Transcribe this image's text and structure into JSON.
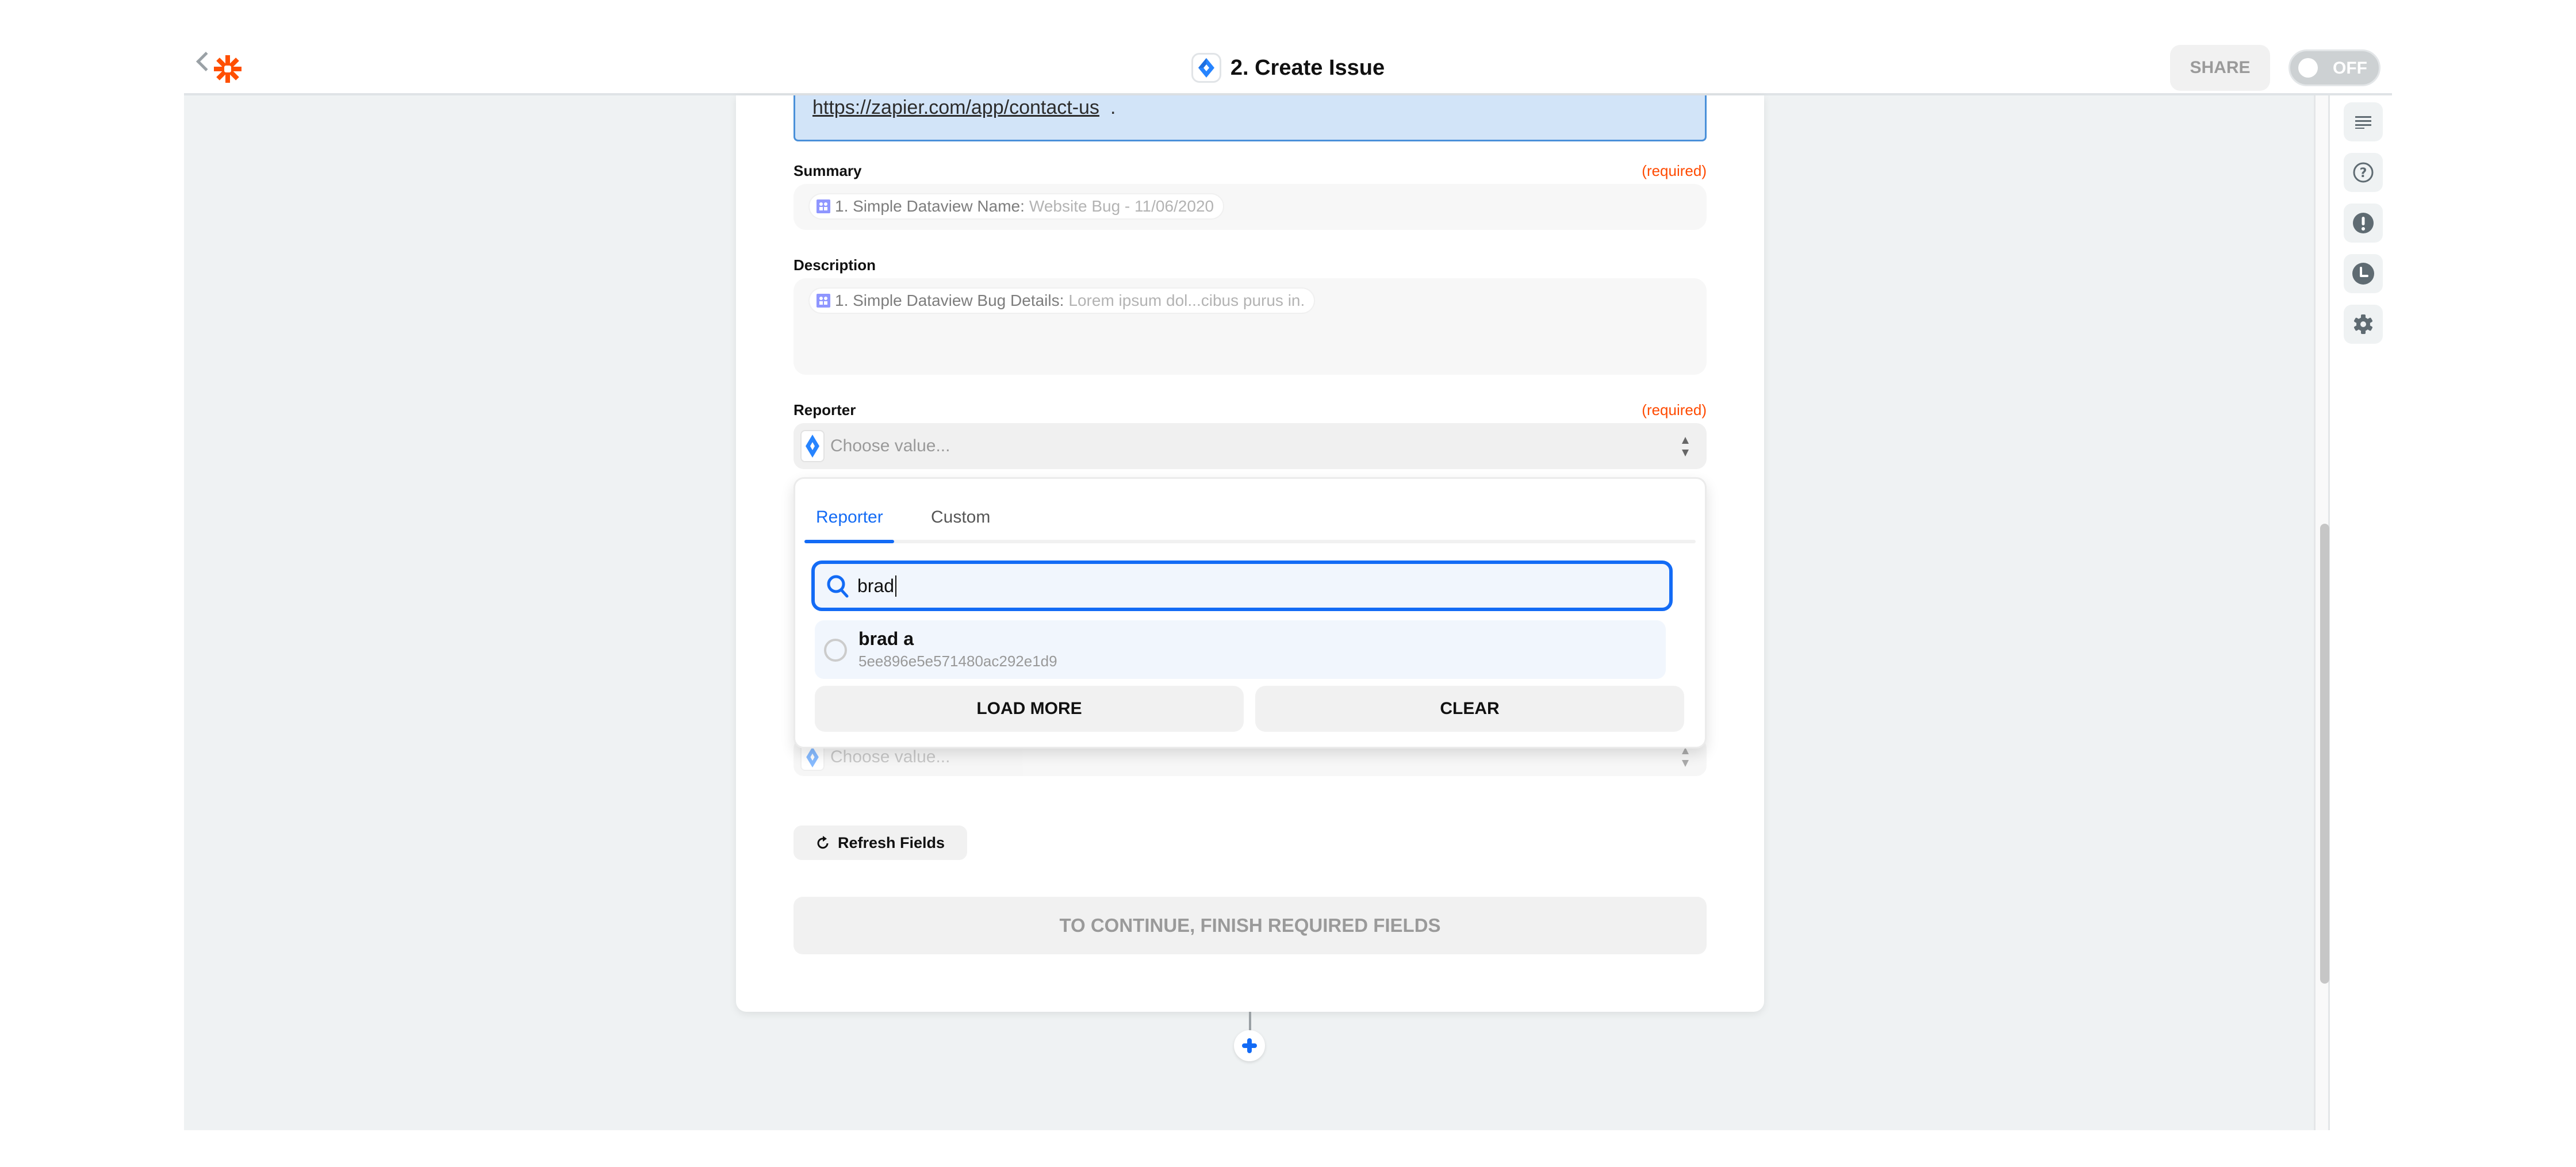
{
  "header": {
    "step_title": "2. Create Issue",
    "share_label": "SHARE",
    "toggle_label": "OFF",
    "toggle_state": "off"
  },
  "colors": {
    "brand_orange": "#ff4f00",
    "accent_blue": "#136bf5",
    "required_orange": "#ff4a00",
    "info_bg": "#d2e4f8"
  },
  "info_box": {
    "link_text": "https://zapier.com/app/contact-us",
    "trailing": "."
  },
  "fields": {
    "summary": {
      "label": "Summary",
      "required_label": "(required)",
      "pill_key": "1. Simple Dataview Name:",
      "pill_value": "Website Bug - 11/06/2020"
    },
    "description": {
      "label": "Description",
      "pill_key": "1. Simple Dataview Bug Details:",
      "pill_value": "Lorem ipsum dol...cibus purus in."
    },
    "reporter": {
      "label": "Reporter",
      "required_label": "(required)",
      "placeholder": "Choose value..."
    },
    "hidden_select": {
      "placeholder": "Choose value..."
    }
  },
  "dropdown": {
    "tabs": [
      {
        "label": "Reporter",
        "active": true
      },
      {
        "label": "Custom",
        "active": false
      }
    ],
    "search_value": "brad",
    "options": [
      {
        "name": "brad a",
        "id": "5ee896e5e571480ac292e1d9",
        "selected": false
      }
    ],
    "load_more_label": "LOAD MORE",
    "clear_label": "CLEAR"
  },
  "actions": {
    "refresh_label": "Refresh Fields",
    "continue_label": "TO CONTINUE, FINISH REQUIRED FIELDS"
  },
  "right_rail": {
    "items": [
      {
        "icon": "details-lines-icon"
      },
      {
        "icon": "help-circle-icon"
      },
      {
        "icon": "alert-icon"
      },
      {
        "icon": "clock-icon"
      },
      {
        "icon": "gear-icon"
      }
    ]
  }
}
